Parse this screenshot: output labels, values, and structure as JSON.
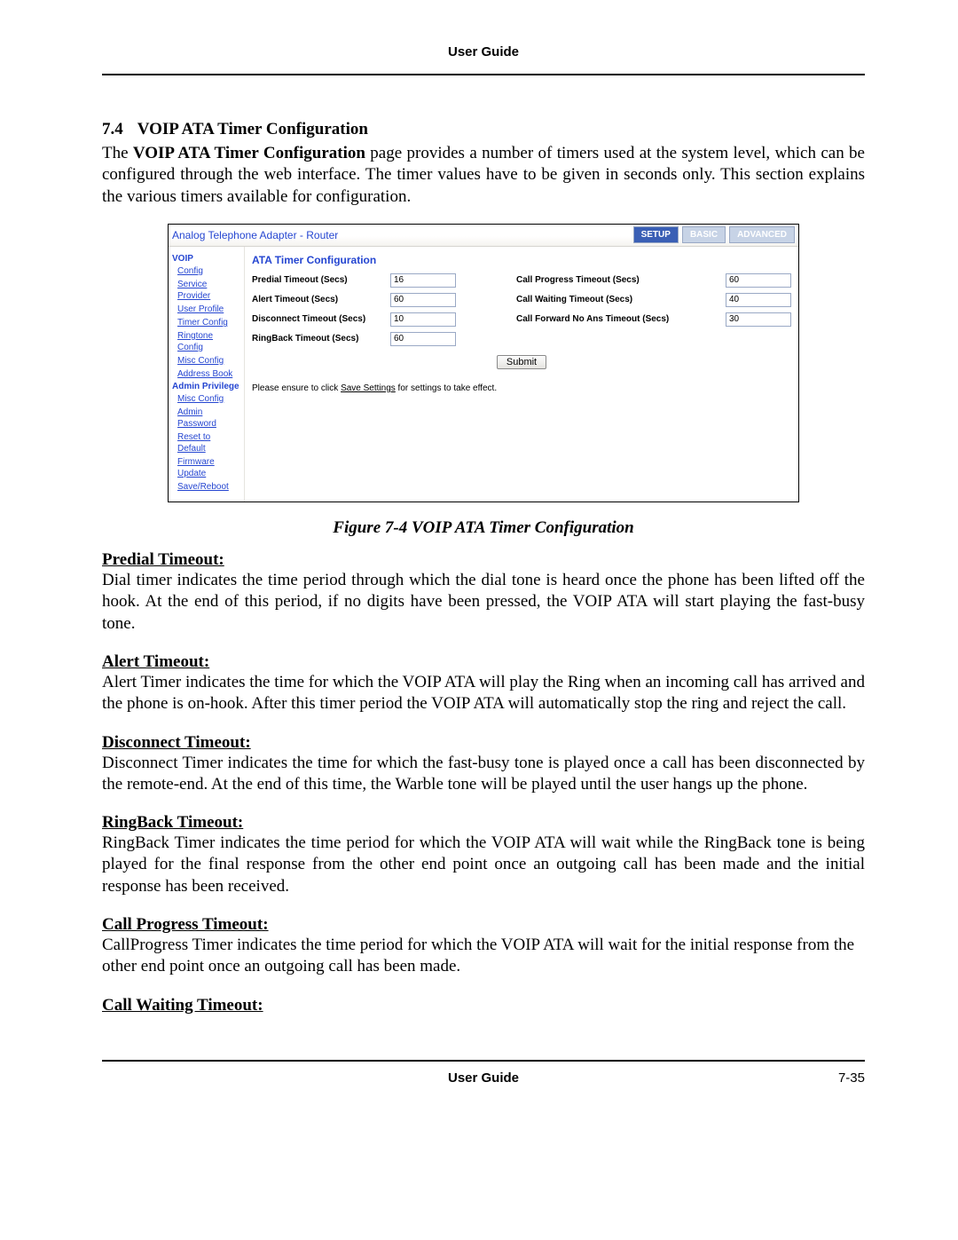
{
  "doc": {
    "header": "User Guide",
    "section_num": "7.4",
    "section_title": "VOIP ATA Timer Configuration",
    "intro_pre": "The ",
    "intro_bold": "VOIP ATA Timer Configuration",
    "intro_post": " page provides a number of timers used at the system level, which can be configured through the web interface. The timer values have to be given in seconds only. This section explains the various timers available for configuration.",
    "figure_caption": "Figure 7-4 VOIP ATA Timer Configuration",
    "footer_center": "User Guide",
    "footer_right": "7-35"
  },
  "screenshot": {
    "brand": "Analog Telephone Adapter - Router",
    "nav": {
      "setup": "SETUP",
      "basic": "BASIC",
      "advanced": "ADVANCED"
    },
    "sidebar": {
      "voip_h": "VOIP",
      "voip_items": [
        "Config",
        "Service Provider",
        "User Profile",
        "Timer Config",
        "Ringtone Config",
        "Misc Config",
        "Address Book"
      ],
      "admin_h": "Admin Privilege",
      "admin_items": [
        "Misc Config",
        "Admin Password",
        "Reset to Default",
        "Firmware Update",
        "Save/Reboot"
      ]
    },
    "main_title": "ATA Timer Configuration",
    "fields": {
      "predial_lbl": "Predial Timeout (Secs)",
      "predial_val": "16",
      "alert_lbl": "Alert Timeout (Secs)",
      "alert_val": "60",
      "disconnect_lbl": "Disconnect Timeout (Secs)",
      "disconnect_val": "10",
      "ringback_lbl": "RingBack Timeout (Secs)",
      "ringback_val": "60",
      "callprogress_lbl": "Call Progress Timeout (Secs)",
      "callprogress_val": "60",
      "callwaiting_lbl": "Call Waiting Timeout (Secs)",
      "callwaiting_val": "40",
      "callfwdnoans_lbl": "Call Forward No Ans Timeout (Secs)",
      "callfwdnoans_val": "30"
    },
    "submit_label": "Submit",
    "save_note_pre": "Please ensure to click ",
    "save_note_link": "Save Settings",
    "save_note_post": " for settings to take effect."
  },
  "sections": {
    "predial_h": "Predial Timeout:",
    "predial_p": "Dial timer indicates the time period through which the dial tone is heard once the phone has been lifted off the hook. At the end of this period, if no digits have been pressed, the VOIP ATA will start playing the fast-busy tone.",
    "alert_h": "Alert Timeout:",
    "alert_p": "Alert Timer indicates the time for which the VOIP ATA will play the Ring when an incoming call has arrived and the phone is on-hook. After this timer period the VOIP ATA will automatically stop the ring and reject the call.",
    "disconnect_h": "Disconnect Timeout:",
    "disconnect_p": "Disconnect Timer indicates the time for which the fast-busy tone is played once a call has been disconnected by the remote-end. At the end of this time, the Warble tone will be played until the user hangs up the phone.",
    "ringback_h": "RingBack Timeout:",
    "ringback_p": "RingBack Timer indicates the time period for which the VOIP ATA will wait while the RingBack tone is being played for the final response from the other end point once an outgoing call has been made and the initial response has been received.",
    "callprogress_h": "Call Progress Timeout:",
    "callprogress_p": "CallProgress Timer indicates the time period for which the VOIP ATA will wait for the initial response from the other end point once an outgoing call has been made.",
    "callwaiting_h": "Call Waiting Timeout:"
  }
}
